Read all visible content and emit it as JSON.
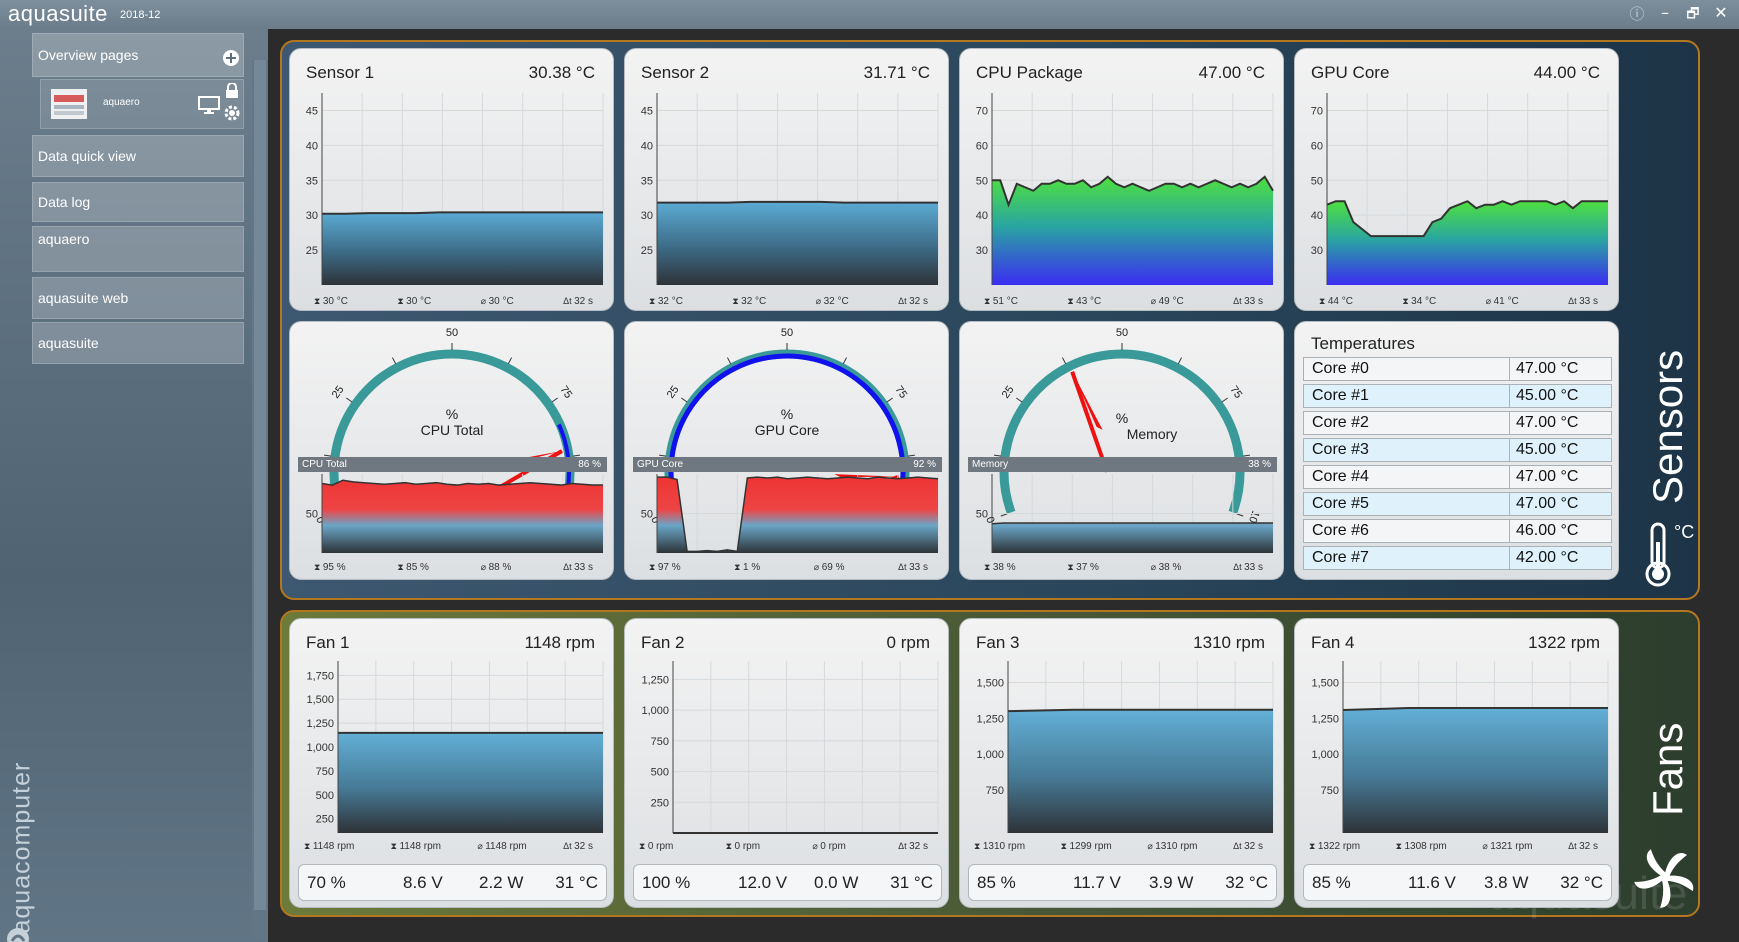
{
  "app": {
    "title": "aquasuite",
    "version": "2018-12"
  },
  "window_controls": {
    "info": "ⓘ",
    "minimize": "–",
    "maximize": "🗗",
    "close": "✕"
  },
  "sidebar": {
    "overview_pages": "Overview pages",
    "device": "aquaero",
    "items": [
      "Data quick view",
      "Data log",
      "aquaero",
      "aquasuite web",
      "aquasuite"
    ],
    "brand": "aquacomputer"
  },
  "groups": {
    "sensors": "Sensors",
    "fans": "Fans",
    "sensors_unit": "°C"
  },
  "temp_cards": [
    {
      "title": "Sensor 1",
      "value": "30.38 °C",
      "ticks": [
        "45",
        "40",
        "35",
        "30",
        "25"
      ],
      "yrange": [
        20,
        50
      ],
      "ylim_ticks": [
        45,
        40,
        35,
        30,
        25
      ],
      "stats": [
        "30 °C",
        "30 °C",
        "30 °C",
        "32 s"
      ],
      "color": "#4f9cc4",
      "series": [
        30.2,
        30.2,
        30.3,
        30.3,
        30.3,
        30.4,
        30.4,
        30.4,
        30.4,
        30.4,
        30.4,
        30.4,
        30.4
      ]
    },
    {
      "title": "Sensor 2",
      "value": "31.71 °C",
      "ticks": [
        "45",
        "40",
        "35",
        "30",
        "25"
      ],
      "ylim_ticks": [
        45,
        40,
        35,
        30,
        25
      ],
      "stats": [
        "32 °C",
        "32 °C",
        "32 °C",
        "32 s"
      ],
      "color": "#4f9cc4",
      "series": [
        31.8,
        31.8,
        31.8,
        31.8,
        31.9,
        31.9,
        31.9,
        31.9,
        31.8,
        31.8,
        31.8,
        31.8,
        31.8
      ]
    },
    {
      "title": "CPU Package",
      "value": "47.00 °C",
      "ticks": [
        "70",
        "60",
        "50",
        "40",
        "30"
      ],
      "ylim_ticks": [
        70,
        60,
        50,
        40,
        30
      ],
      "stats": [
        "51 °C",
        "43 °C",
        "49 °C",
        "33 s"
      ],
      "color": "gradient-green",
      "series": [
        50,
        50,
        43,
        49,
        48,
        47,
        49,
        49,
        50,
        49,
        49,
        50,
        48,
        49,
        51,
        49,
        48,
        49,
        48,
        47,
        48,
        49,
        49,
        48,
        49,
        48,
        49,
        50,
        49,
        48,
        49,
        48,
        49,
        51,
        47
      ]
    },
    {
      "title": "GPU Core",
      "value": "44.00 °C",
      "ticks": [
        "70",
        "60",
        "50",
        "40",
        "30"
      ],
      "ylim_ticks": [
        70,
        60,
        50,
        40,
        30
      ],
      "stats": [
        "44 °C",
        "34 °C",
        "41 °C",
        "33 s"
      ],
      "color": "gradient-green",
      "series": [
        43,
        44,
        44,
        38,
        36,
        34,
        34,
        34,
        34,
        34,
        34,
        34,
        38,
        39,
        42,
        43,
        44,
        42,
        43,
        43,
        44,
        43,
        44,
        44,
        44,
        44,
        43,
        44,
        42,
        44,
        44,
        44,
        44
      ]
    }
  ],
  "gauges": [
    {
      "label": "CPU Total",
      "unit": "%",
      "bar_label": "CPU Total",
      "bar_value": "86 %",
      "value": 86,
      "scale": [
        "0",
        "25",
        "50",
        "75",
        "100"
      ],
      "stats": [
        "95 %",
        "85 %",
        "88 %",
        "33 s"
      ],
      "tick": "50",
      "series": [
        88,
        86,
        92,
        90,
        89,
        88,
        87,
        88,
        89,
        87,
        88,
        89,
        87,
        86,
        88,
        87,
        88,
        86,
        87,
        88,
        89,
        88,
        87,
        86,
        88,
        87,
        86,
        86
      ]
    },
    {
      "label": "GPU Core",
      "unit": "%",
      "bar_label": "GPU Core",
      "bar_value": "92 %",
      "value": 92,
      "scale": [
        "0",
        "25",
        "50",
        "75",
        "100"
      ],
      "stats": [
        "97 %",
        "1 %",
        "69 %",
        "33 s"
      ],
      "tick": "50",
      "series": [
        96,
        96,
        93,
        2,
        2,
        3,
        2,
        4,
        2,
        95,
        96,
        95,
        96,
        94,
        95,
        96,
        95,
        94,
        95,
        96,
        95,
        94,
        96,
        95,
        94,
        95,
        96,
        95,
        94
      ]
    },
    {
      "label": "Memory",
      "unit": "%",
      "bar_label": "Memory",
      "bar_value": "38 %",
      "value": 38,
      "scale": [
        "0",
        "25",
        "50",
        "75",
        "100"
      ],
      "stats": [
        "38 %",
        "37 %",
        "38 %",
        "33 s"
      ],
      "tick": "50",
      "series": [
        37,
        38,
        38,
        38,
        38,
        38,
        38,
        38,
        38,
        38,
        38,
        38,
        38,
        38,
        38,
        38,
        38,
        38,
        38,
        38,
        38,
        38,
        38,
        38,
        38
      ]
    }
  ],
  "temperatures": {
    "title": "Temperatures",
    "rows": [
      {
        "name": "Core #0",
        "value": "47.00 °C"
      },
      {
        "name": "Core #1",
        "value": "45.00 °C"
      },
      {
        "name": "Core #2",
        "value": "47.00 °C"
      },
      {
        "name": "Core #3",
        "value": "45.00 °C"
      },
      {
        "name": "Core #4",
        "value": "47.00 °C"
      },
      {
        "name": "Core #5",
        "value": "47.00 °C"
      },
      {
        "name": "Core #6",
        "value": "46.00 °C"
      },
      {
        "name": "Core #7",
        "value": "42.00 °C"
      }
    ]
  },
  "fans": [
    {
      "title": "Fan 1",
      "value": "1148 rpm",
      "ticks": [
        "1,750",
        "1,500",
        "1,250",
        "1,000",
        "750",
        "500",
        "250"
      ],
      "ylim_ticks": [
        1750,
        1500,
        1250,
        1000,
        750,
        500,
        250
      ],
      "ymin": 100,
      "ymax": 1900,
      "stats": [
        "1148 rpm",
        "1148 rpm",
        "1148 rpm",
        "32 s"
      ],
      "series": [
        1148,
        1148
      ],
      "power": "70 %",
      "voltage": "8.6 V",
      "watts": "2.2 W",
      "temp": "31 °C"
    },
    {
      "title": "Fan 2",
      "value": "0 rpm",
      "ticks": [
        "1,250",
        "1,000",
        "750",
        "500",
        "250"
      ],
      "ylim_ticks": [
        1250,
        1000,
        750,
        500,
        250
      ],
      "ymin": 0,
      "ymax": 1400,
      "stats": [
        "0 rpm",
        "0 rpm",
        "0 rpm",
        "32 s"
      ],
      "series": [
        0,
        0
      ],
      "power": "100 %",
      "voltage": "12.0 V",
      "watts": "0.0 W",
      "temp": "31 °C"
    },
    {
      "title": "Fan 3",
      "value": "1310 rpm",
      "ticks": [
        "1,500",
        "1,250",
        "1,000",
        "750"
      ],
      "ylim_ticks": [
        1500,
        1250,
        1000,
        750
      ],
      "ymin": 450,
      "ymax": 1650,
      "stats": [
        "1310 rpm",
        "1299 rpm",
        "1310 rpm",
        "32 s"
      ],
      "series": [
        1300,
        1310,
        1310,
        1310,
        1310
      ],
      "power": "85 %",
      "voltage": "11.7 V",
      "watts": "3.9 W",
      "temp": "32 °C"
    },
    {
      "title": "Fan 4",
      "value": "1322 rpm",
      "ticks": [
        "1,500",
        "1,250",
        "1,000",
        "750"
      ],
      "ylim_ticks": [
        1500,
        1250,
        1000,
        750
      ],
      "ymin": 450,
      "ymax": 1650,
      "stats": [
        "1322 rpm",
        "1308 rpm",
        "1321 rpm",
        "32 s"
      ],
      "series": [
        1308,
        1322,
        1322,
        1322,
        1322
      ],
      "power": "85 %",
      "voltage": "11.6 V",
      "watts": "3.8 W",
      "temp": "32 °C"
    }
  ],
  "watermark": "aquasuite",
  "colors": {
    "accent_border": "#b3771f",
    "temp_area": "#5aa8d0",
    "gauge_arc": "#3a9a9a",
    "needle": "#ee1111",
    "bar_red": "#ee3333"
  }
}
